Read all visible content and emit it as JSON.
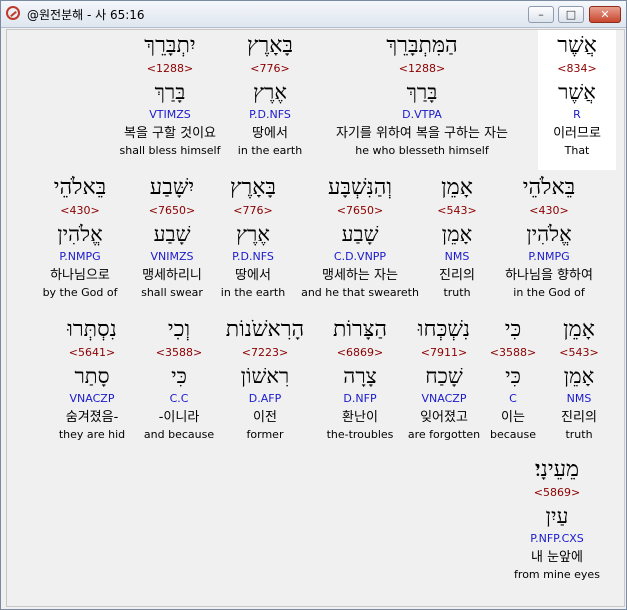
{
  "window": {
    "title": "@원전분해 - 사 65:16",
    "minimize": "–",
    "maximize": "□",
    "close": "✕"
  },
  "rows": [
    {
      "words": [
        {
          "heb": "אֲשֶׁר",
          "strong": "<834>",
          "lemma": "אֲשֶׁר",
          "morph": "R",
          "kor": "이러므로",
          "eng": "That"
        },
        {
          "heb": "הַמִּתְבָּרֵךְ",
          "strong": "<1288>",
          "lemma": "בָּרַךְ",
          "morph": "D.VTPA",
          "kor": "자기를 위하여 복을 구하는 자는",
          "eng": "he who blesseth himself"
        },
        {
          "heb": "בָּאָרֶץ",
          "strong": "<776>",
          "lemma": "אֶרֶץ",
          "morph": "P.D.NFS",
          "kor": "땅에서",
          "eng": "in the earth"
        },
        {
          "heb": "יִתְבָּרֵךְ",
          "strong": "<1288>",
          "lemma": "בָּרַךְ",
          "morph": "VTIMZS",
          "kor": "복을 구할 것이요",
          "eng": "shall bless himself"
        }
      ]
    },
    {
      "words": [
        {
          "heb": "בֵּאלֹהֵי",
          "strong": "<430>",
          "lemma": "אֱלֹהִין",
          "morph": "P.NMPG",
          "kor": "하나님을 향하여",
          "eng": "in the God of"
        },
        {
          "heb": "אָמֵן",
          "strong": "<543>",
          "lemma": "אָמֵן",
          "morph": "NMS",
          "kor": "진리의",
          "eng": "truth"
        },
        {
          "heb": "וְהַנִּשְׁבָּע",
          "strong": "<7650>",
          "lemma": "שָׁבַע",
          "morph": "C.D.VNPP",
          "kor": "맹세하는 자는",
          "eng": "and he that sweareth"
        },
        {
          "heb": "בָּאָרֶץ",
          "strong": "<776>",
          "lemma": "אֶרֶץ",
          "morph": "P.D.NFS",
          "kor": "땅에서",
          "eng": "in the earth"
        },
        {
          "heb": "יִשָּׁבַע",
          "strong": "<7650>",
          "lemma": "שָׁבַע",
          "morph": "VNIMZS",
          "kor": "맹세하리니",
          "eng": "shall swear"
        },
        {
          "heb": "בֵּאלֹהֵי",
          "strong": "<430>",
          "lemma": "אֱלֹהִין",
          "morph": "P.NMPG",
          "kor": "하나님으로",
          "eng": "by the God of"
        }
      ]
    },
    {
      "words": [
        {
          "heb": "אָמֵן",
          "strong": "<543>",
          "lemma": "אָמֵן",
          "morph": "NMS",
          "kor": "진리의",
          "eng": "truth"
        },
        {
          "heb": "כִּי",
          "strong": "<3588>",
          "lemma": "כִּי",
          "morph": "C",
          "kor": "이는",
          "eng": "because"
        },
        {
          "heb": "נִשְׁכְּחוּ",
          "strong": "<7911>",
          "lemma": "שָׁכַח",
          "morph": "VNACZP",
          "kor": "잊어졌고",
          "eng": "are forgotten"
        },
        {
          "heb": "הַצָּרוֹת",
          "strong": "<6869>",
          "lemma": "צָרָה",
          "morph": "D.NFP",
          "kor": "환난이",
          "eng": "the-troubles"
        },
        {
          "heb": "הָרִאשֹׁנוֹת",
          "strong": "<7223>",
          "lemma": "רִאשׁוֹן",
          "morph": "D.AFP",
          "kor": "이전",
          "eng": "former"
        },
        {
          "heb": "וְכִי",
          "strong": "<3588>",
          "lemma": "כִּי",
          "morph": "C.C",
          "kor": "-이니라",
          "eng": "and because"
        },
        {
          "heb": "נִסְתְּרוּ",
          "strong": "<5641>",
          "lemma": "סָתַר",
          "morph": "VNACZP",
          "kor": "숨겨졌음-",
          "eng": "they are hid"
        }
      ]
    },
    {
      "words": [
        {
          "heb": "מֵעֵינָי׃",
          "strong": "<5869>",
          "lemma": "עַיִן",
          "morph": "P.NFP.CXS",
          "kor": "내 눈앞에",
          "eng": "from mine eyes"
        }
      ]
    }
  ]
}
